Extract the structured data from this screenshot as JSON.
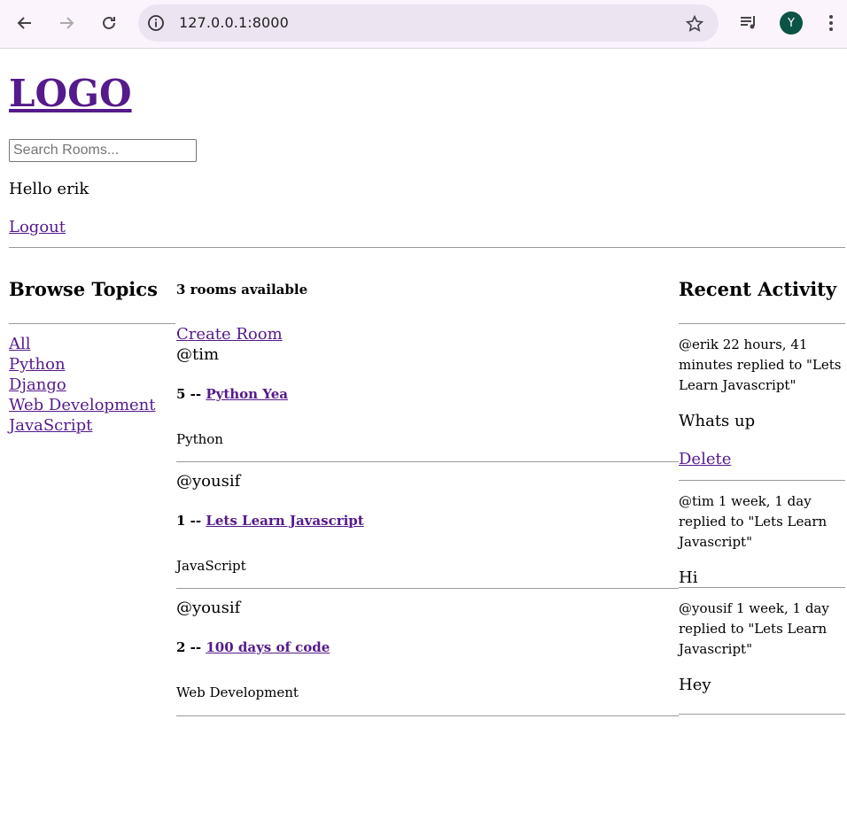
{
  "browser": {
    "url": "127.0.0.1:8000",
    "avatar_letter": "Y",
    "avatar_color": "#0b5345"
  },
  "header": {
    "logo": "LOGO",
    "search_placeholder": "Search Rooms...",
    "greeting": "Hello erik",
    "logout": "Logout"
  },
  "topics": {
    "heading": "Browse Topics",
    "items": [
      "All",
      "Python",
      "Django",
      "Web Development",
      "JavaScript"
    ]
  },
  "rooms": {
    "count_text": "3 rooms available",
    "create_label": "Create Room",
    "items": [
      {
        "host": "@tim",
        "id": "5",
        "name": "Python Yea",
        "topic": "Python"
      },
      {
        "host": "@yousif",
        "id": "1",
        "name": "Lets Learn Javascript",
        "topic": "JavaScript"
      },
      {
        "host": "@yousif",
        "id": "2",
        "name": "100 days of code",
        "topic": "Web Development"
      }
    ]
  },
  "activity": {
    "heading": "Recent Activity",
    "items": [
      {
        "meta": "@erik 22 hours, 41 minutes replied to \"Lets Learn Javascript\"",
        "body": "Whats up",
        "delete": "Delete"
      },
      {
        "meta": "@tim 1 week, 1 day replied to \"Lets Learn Javascript\"",
        "body": "Hi"
      },
      {
        "meta": "@yousif 1 week, 1 day replied to \"Lets Learn Javascript\"",
        "body": "Hey"
      }
    ]
  }
}
